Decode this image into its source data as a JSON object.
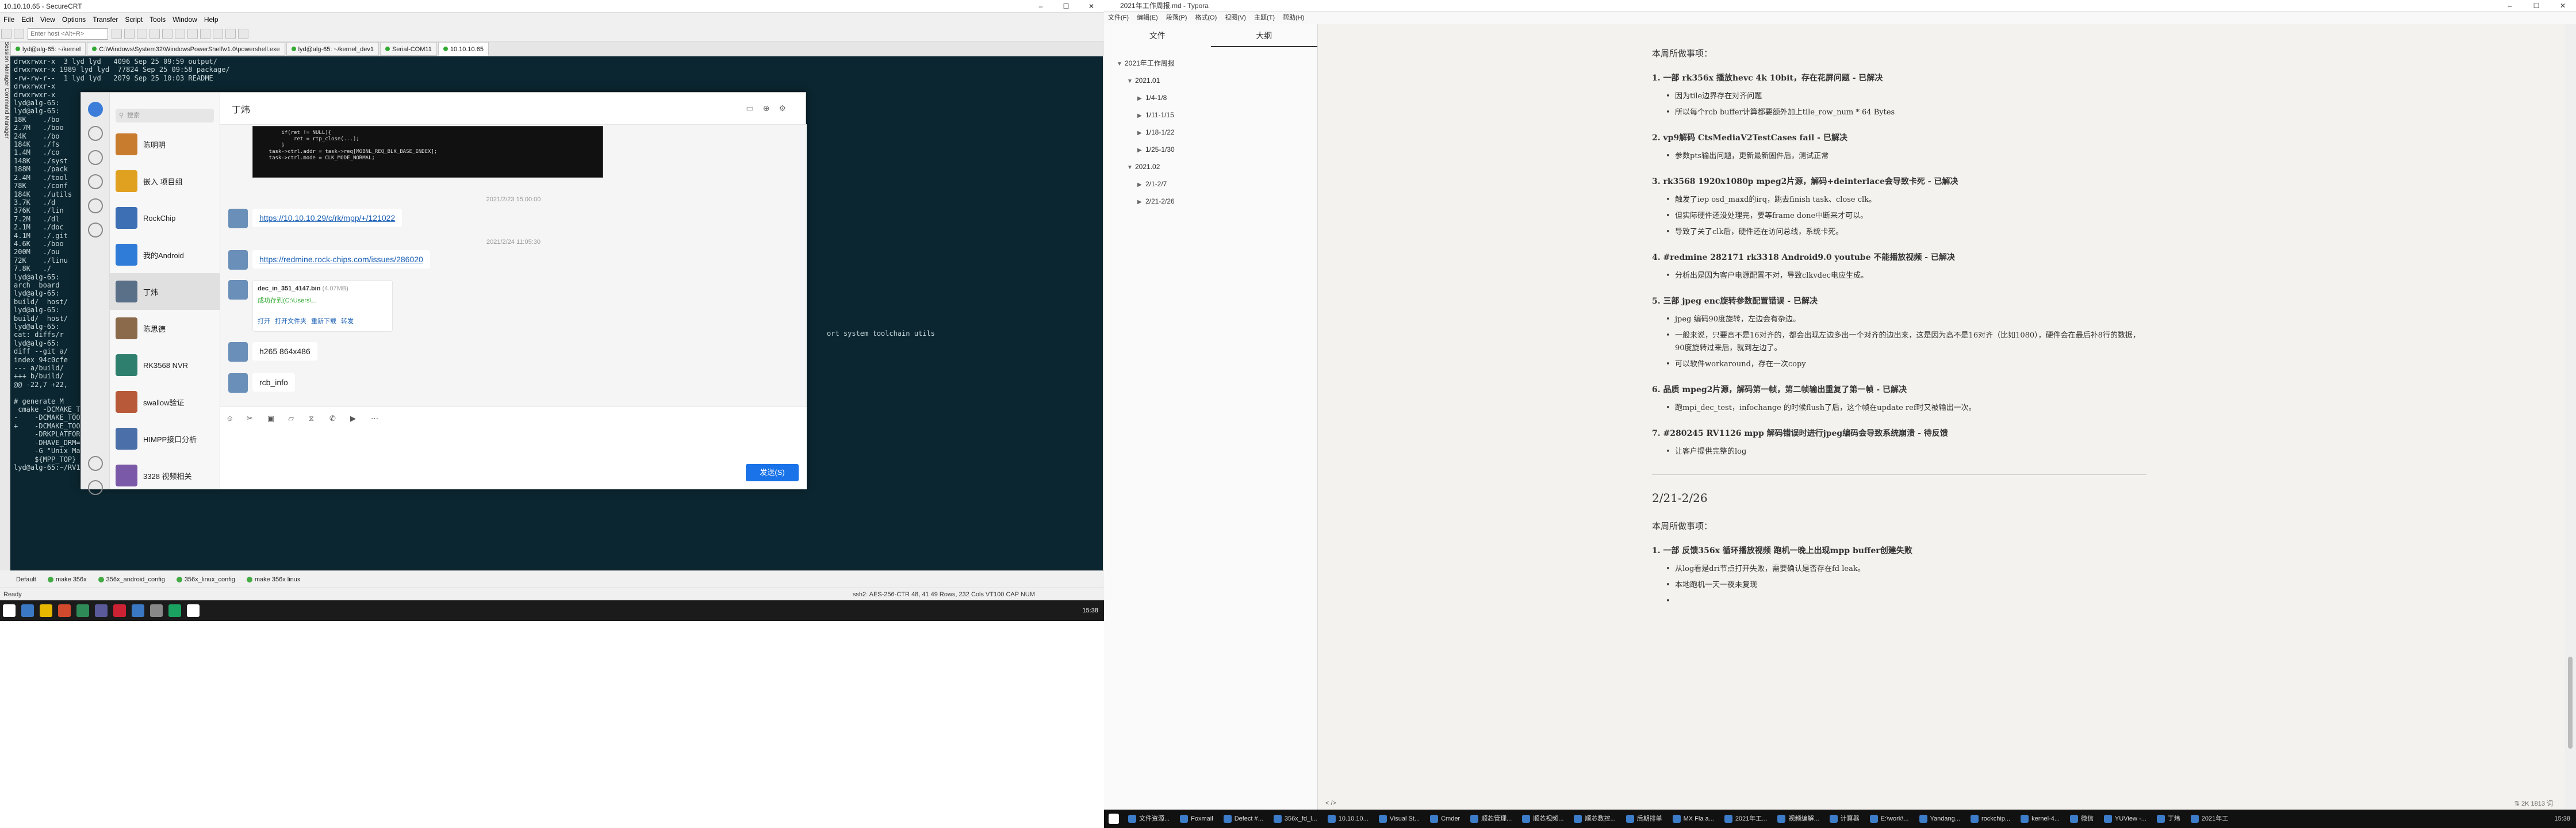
{
  "crt": {
    "title": "10.10.10.65 - SecureCRT",
    "win_controls": [
      "–",
      "☐",
      "✕"
    ],
    "menu": [
      "File",
      "Edit",
      "View",
      "Options",
      "Transfer",
      "Script",
      "Tools",
      "Window",
      "Help"
    ],
    "host_placeholder": "Enter host <Alt+R>",
    "tabs": [
      {
        "label": "lyd@alg-65: ~/kernel",
        "active": false
      },
      {
        "label": "C:\\Windows\\System32\\WindowsPowerShell\\v1.0\\powershell.exe",
        "active": false
      },
      {
        "label": "lyd@alg-65: ~/kernel_dev1",
        "active": false
      },
      {
        "label": "Serial-COM11",
        "active": false
      },
      {
        "label": "10.10.10.65",
        "active": true
      }
    ],
    "side_label": "Session Manager   Command Manager",
    "terminal_lines": [
      "drwxrwxr-x  3 lyd lyd   4096 Sep 25 09:59 output/",
      "drwxrwxr-x 1989 lyd lyd  77824 Sep 25 09:58 package/",
      "-rw-rw-r--  1 lyd lyd   2079 Sep 25 10:03 README",
      "drwxrwxr-x",
      "drwxrwxr-x",
      "lyd@alg-65:",
      "lyd@alg-65:",
      "18K    ./bo",
      "2.7M   ./boo",
      "24K    ./bo",
      "184K   ./fs",
      "1.4M   ./co",
      "148K   ./syst",
      "188M   ./pack",
      "2.4M   ./tool",
      "78K    ./conf",
      "184K   ./utils",
      "3.7K   ./d",
      "376K   ./lin",
      "7.2M   ./dl",
      "2.1M   ./doc",
      "4.1M   ./.git",
      "4.6K   ./boo",
      "200M   ./ou",
      "72K    ./linu",
      "7.8K   ./",
      "lyd@alg-65:",
      "arch  board",
      "lyd@alg-65:",
      "build/  host/",
      "lyd@alg-65:",
      "build/  host/",
      "lyd@alg-65:",
      "cat: diffs/r",
      "lyd@alg-65:",
      "diff --git a/",
      "index 94c0cfe",
      "--- a/build/",
      "+++ b/build/",
      "@@ -22,7 +22,",
      "",
      "# generate M",
      " cmake -DCMAKE_TOOLCHAIN_FILE=./arm.linux.cross.cmake \\",
      "-    -DCMAKE_TOOLCHAIN_FILE=/home/lyd/RV1109_SDK/sdk/buildroot/output/rockchip_rv1126_rv1109/host/share/buildroot/toolchainfile.cmake \\",
      "+    -DCMAKE_TOOLCHAIN_FILE=/home/lyd/RV1109_SDK/sdk/buildroot/output/rockchip_rv1126_rv1109/host/share/buildroot/toolchainfile.cmake \\",
      "     -DRKPLATFORM=ON \\",
      "     -DHAVE_DRM=ON \\",
      "     -G \"Unix Makefiles\" \\",
      "     ${MPP_TOP}",
      "lyd@alg-65:~/RV1109_SDK/sdk/buildroot$ "
    ],
    "terminal_right_text": "ort  system  toolchain  utils",
    "bottom_tabs": [
      "Default",
      "make 356x",
      "356x_android_config",
      "356x_linux_config",
      "make 356x linux"
    ],
    "status_left": "Ready",
    "status_right": "ssh2: AES-256-CTR     48,  41   49 Rows, 232 Cols   VT100   CAP  NUM",
    "clock": "15:38"
  },
  "chat": {
    "search_placeholder": "搜索",
    "contacts": [
      {
        "name": "陈明明",
        "color": "#c87d2e"
      },
      {
        "name": "嵌入 项目组",
        "color": "#e0a020"
      },
      {
        "name": "RockChip",
        "color": "#3d6fb5"
      },
      {
        "name": "我的Android",
        "color": "#2e7bd8"
      },
      {
        "name": "丁炜",
        "color": "#5a6f88"
      },
      {
        "name": "陈思德",
        "color": "#8a6a4a"
      },
      {
        "name": "RK3568 NVR",
        "color": "#2f7f6f"
      },
      {
        "name": "swallow验证",
        "color": "#b85a3a"
      },
      {
        "name": "HIMPP接口分析",
        "color": "#4b6fa8"
      },
      {
        "name": "3328 视频相关",
        "color": "#7a5aa8"
      }
    ],
    "selected_contact": "丁炜",
    "header_name": "丁炜",
    "code_lines": [
      "        if(ret != NULL){",
      "            ret = rtp_close(...);",
      "        }",
      "    task->ctrl.addr = task->req[MOBNL_REQ_BLK_BASE_INDEX];",
      "    task->ctrl.mode = CLK_MODE_NORMAL;"
    ],
    "ts1": "2021/2/23 15:00:00",
    "link1": "https://10.10.10.29/c/rk/mpp/+/121022",
    "ts2": "2021/2/24 11:05:30",
    "link2": "https://redmine.rock-chips.com/issues/286020",
    "file_name": "dec_in_351_4147.bin",
    "file_size": "(4.07MB)",
    "file_status": "成功存到(C:\\Users\\...",
    "file_actions": [
      "打开",
      "打开文件夹",
      "重新下载",
      "转发"
    ],
    "msg_h265": "h265 864x486",
    "msg_rcb": "rcb_info",
    "send_label": "发送(S)"
  },
  "typora": {
    "title": "2021年工作周报.md - Typora",
    "win_controls": [
      "–",
      "☐",
      "✕"
    ],
    "menu": [
      "文件(F)",
      "编辑(E)",
      "段落(P)",
      "格式(O)",
      "视图(V)",
      "主题(T)",
      "帮助(H)"
    ],
    "side_tabs": [
      "文件",
      "大纲"
    ],
    "outline": [
      {
        "label": "2021年工作周报",
        "level": 0,
        "tri": "▼"
      },
      {
        "label": "2021.01",
        "level": 1,
        "tri": "▼"
      },
      {
        "label": "1/4-1/8",
        "level": 2,
        "tri": "▶"
      },
      {
        "label": "1/11-1/15",
        "level": 2,
        "tri": "▶"
      },
      {
        "label": "1/18-1/22",
        "level": 2,
        "tri": "▶"
      },
      {
        "label": "1/25-1/30",
        "level": 2,
        "tri": "▶"
      },
      {
        "label": "2021.02",
        "level": 1,
        "tri": "▼"
      },
      {
        "label": "2/1-2/7",
        "level": 2,
        "tri": "▶"
      },
      {
        "label": "2/21-2/26",
        "level": 2,
        "tri": "▶"
      }
    ],
    "doc_heading": "本周所做事项：",
    "items": [
      {
        "title": "1. 一部 rk356x 播放hevc 4k 10bit，存在花屏问题 - 已解决",
        "bullets": [
          "因为tile边界存在对齐问题",
          "所以每个rcb buffer计算都要额外加上tile_row_num * 64 Bytes"
        ]
      },
      {
        "title": "2. vp9解码 CtsMediaV2TestCases fail - 已解决",
        "bullets": [
          "参数pts输出问题，更新最新固件后，测试正常"
        ]
      },
      {
        "title": "3. rk3568 1920x1080p mpeg2片源，解码+deinterlace会导致卡死 - 已解决",
        "bullets": [
          "触发了iep osd_maxd的irq，跳去finish task、close clk。",
          "但实际硬件还没处理完，要等frame done中断来才可以。",
          "导致了关了clk后，硬件还在访问总线，系统卡死。"
        ]
      },
      {
        "title": "4. #redmine 282171 rk3318 Android9.0 youtube 不能播放视频 - 已解决",
        "bullets": [
          "分析出是因为客户电源配置不对，导致clkvdec电应生成。"
        ]
      },
      {
        "title": "5. 三部 jpeg enc旋转参数配置错误 - 已解决",
        "bullets": [
          "jpeg 编码90度旋转，左边会有杂边。",
          "一般来说，只要高不是16对齐的，都会出现左边多出一个对齐的边出来，这是因为高不是16对齐（比如1080），硬件会在最后补8行的数据，90度旋转过来后，就到左边了。",
          "可以软件workaround，存在一次copy"
        ]
      },
      {
        "title": "6. 品质 mpeg2片源，解码第一帧，第二帧输出重复了第一帧 - 已解决",
        "bullets": [
          "跑mpi_dec_test，infochange 的时候flush了后，这个帧在update ref时又被输出一次。"
        ]
      },
      {
        "title": "7. #280245 RV1126 mpp 解码错误时进行jpeg编码会导致系统崩溃 - 待反馈",
        "bullets": [
          "让客户提供完整的log"
        ]
      }
    ],
    "section2_title": "2/21-2/26",
    "section2_heading": "本周所做事项：",
    "items2": [
      {
        "title": "1. 一部 反馈356x 循环播放视频 跑机一晚上出现mpp buffer创建失败",
        "bullets": [
          "从log看是dri节点打开失败，需要确认是否存在fd leak。",
          "本地跑机一天一夜未复现",
          ""
        ]
      }
    ],
    "status_left": "<  />",
    "status_right": "⇅ 2K    1813 词",
    "taskbar": [
      "文件资源...",
      "Foxmail",
      "Defect #...",
      "356x_fd_l...",
      "10.10.10...",
      "Visual St...",
      "Cmder",
      "顺芯管理...",
      "顺芯视频...",
      "顺芯数控...",
      "后期排单",
      "MX Fla a...",
      "2021年工...",
      "视频编解...",
      "计算器",
      "E:\\work\\...",
      "Yandang...",
      "rockchip...",
      "kernel-4...",
      "微信",
      "YUView -...",
      "丁炜",
      "2021年工"
    ],
    "clock": "15:38"
  }
}
